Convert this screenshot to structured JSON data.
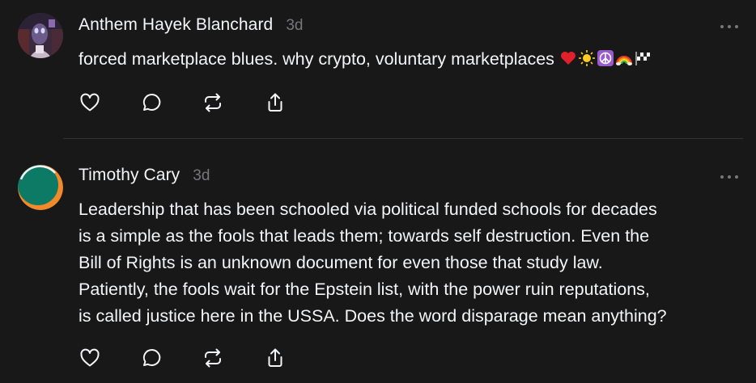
{
  "posts": [
    {
      "author": "Anthem Hayek Blanchard",
      "time": "3d",
      "text": "forced marketplace blues. why crypto, voluntary marketplaces",
      "emojis": [
        "heart-emoji",
        "sun-emoji",
        "peace-emoji",
        "rainbow-emoji",
        "checkered-flag-emoji"
      ],
      "actions": [
        "heart-icon",
        "comment-icon",
        "repost-icon",
        "share-icon"
      ]
    },
    {
      "author": "Timothy Cary",
      "time": "3d",
      "text": "Leadership that has been schooled via political funded schools for decades\nis a simple as the fools that leads them; towards self destruction. Even the\nBill of Rights is an unknown document for even those that study law.\nPatiently, the fools wait for the Epstein list, with the power ruin reputations,\nis called justice here in the USSA. Does the word disparage mean anything?",
      "actions": [
        "heart-icon",
        "comment-icon",
        "repost-icon",
        "share-icon"
      ]
    }
  ],
  "colors": {
    "background": "#181819",
    "text": "#f3f5f7",
    "secondary": "#77777a",
    "divider": "#323234"
  }
}
